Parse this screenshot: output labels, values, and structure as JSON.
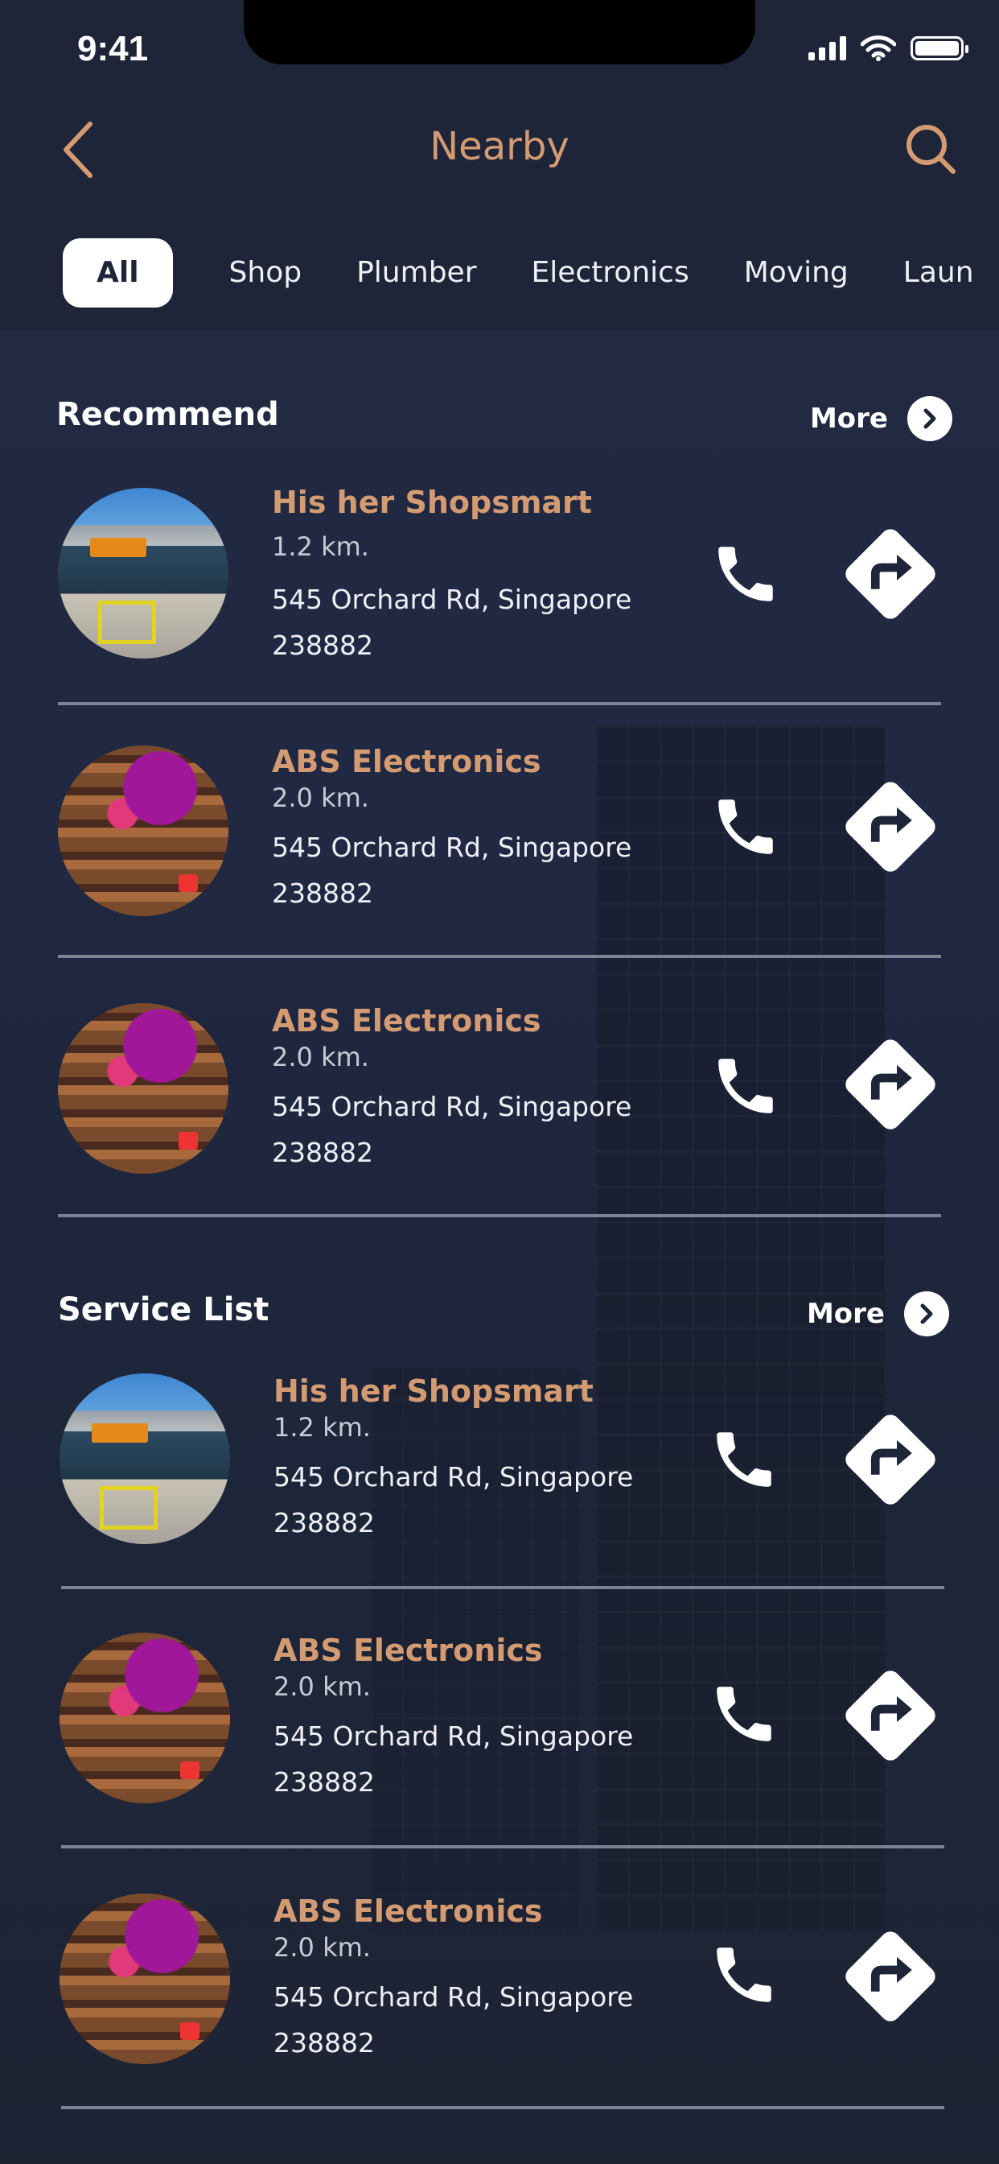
{
  "status_bar": {
    "time": "9:41"
  },
  "header": {
    "title": "Nearby"
  },
  "filters": [
    "All",
    "Shop",
    "Plumber",
    "Electronics",
    "Moving",
    "Laun"
  ],
  "sections": [
    {
      "title": "Recommend",
      "more_label": "More",
      "items": [
        {
          "name": "His her Shopsmart",
          "distance": "1.2 km.",
          "address": "545 Orchard Rd, Singapore 238882",
          "image": "shop"
        },
        {
          "name": "ABS Electronics",
          "distance": "2.0 km.",
          "address": "545 Orchard Rd, Singapore 238882",
          "image": "electronics"
        },
        {
          "name": "ABS Electronics",
          "distance": "2.0 km.",
          "address": "545 Orchard Rd, Singapore 238882",
          "image": "electronics"
        }
      ]
    },
    {
      "title": "Service List",
      "more_label": "More",
      "items": [
        {
          "name": "His her Shopsmart",
          "distance": "1.2 km.",
          "address": "545 Orchard Rd, Singapore 238882",
          "image": "shop"
        },
        {
          "name": "ABS Electronics",
          "distance": "2.0 km.",
          "address": "545 Orchard Rd, Singapore 238882",
          "image": "electronics"
        },
        {
          "name": "ABS Electronics",
          "distance": "2.0 km.",
          "address": "545 Orchard Rd, Singapore 238882",
          "image": "electronics"
        }
      ]
    }
  ],
  "icons": [
    "back-arrow-icon",
    "search-icon",
    "phone-icon",
    "directions-icon",
    "chevron-right-icon"
  ],
  "colors": {
    "accent": "#d49b72",
    "background": "#1e2538",
    "text": "#ffffff",
    "divider": "#9ba3b5"
  }
}
